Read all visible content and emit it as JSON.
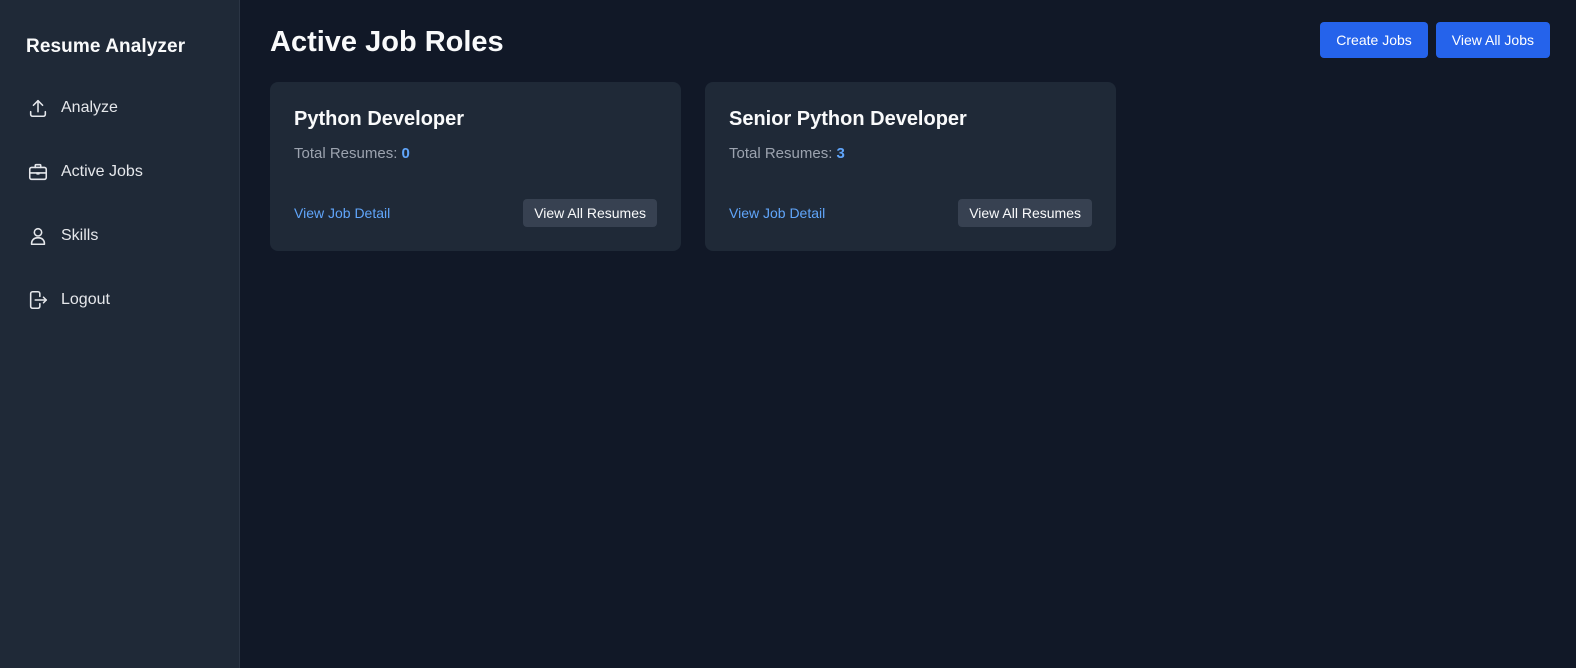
{
  "sidebar": {
    "brand": "Resume Analyzer",
    "items": [
      {
        "label": "Analyze",
        "icon": "upload-icon"
      },
      {
        "label": "Active Jobs",
        "icon": "briefcase-icon"
      },
      {
        "label": "Skills",
        "icon": "user-icon"
      },
      {
        "label": "Logout",
        "icon": "logout-icon"
      }
    ]
  },
  "header": {
    "title": "Active Job Roles",
    "create_label": "Create Jobs",
    "view_all_label": "View All Jobs"
  },
  "jobs": [
    {
      "title": "Python Developer",
      "resumes_label": "Total Resumes:",
      "resumes_count": "0",
      "detail_link": "View Job Detail",
      "resumes_button": "View All Resumes"
    },
    {
      "title": "Senior Python Developer",
      "resumes_label": "Total Resumes:",
      "resumes_count": "3",
      "detail_link": "View Job Detail",
      "resumes_button": "View All Resumes"
    }
  ],
  "colors": {
    "background": "#111827",
    "sidebar": "#1f2937",
    "card": "#1f2937",
    "accent": "#2563eb",
    "link": "#60a5fa",
    "secondary_button": "#374151"
  }
}
